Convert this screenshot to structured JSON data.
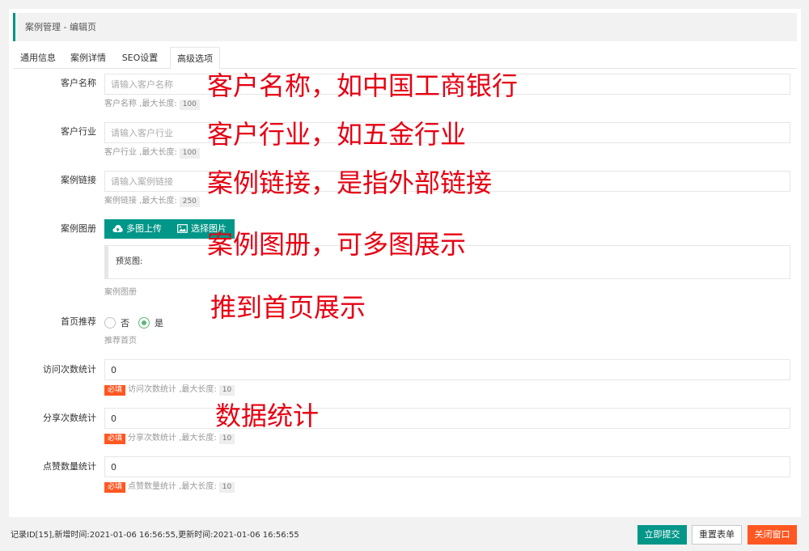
{
  "breadcrumb": "案例管理 - 编辑页",
  "tabs": [
    "通用信息",
    "案例详情",
    "SEO设置",
    "高级选项"
  ],
  "fields": {
    "customer_name": {
      "label": "客户名称",
      "placeholder": "请输入客户名称",
      "hint": "客户名称 ,最大长度:",
      "maxlen": "100"
    },
    "customer_industry": {
      "label": "客户行业",
      "placeholder": "请输入客户行业",
      "hint": "客户行业 ,最大长度:",
      "maxlen": "100"
    },
    "case_link": {
      "label": "案例链接",
      "placeholder": "请输入案例链接",
      "hint": "案例链接 ,最大长度:",
      "maxlen": "250"
    },
    "gallery": {
      "label": "案例图册",
      "upload_btn": "多图上传",
      "select_btn": "选择图片",
      "preview_label": "预览图:",
      "hint": "案例图册"
    },
    "homepage": {
      "label": "首页推荐",
      "option_no": "否",
      "option_yes": "是",
      "selected": "是",
      "hint": "推荐首页"
    },
    "visits": {
      "label": "访问次数统计",
      "value": "0",
      "required": "必填",
      "hint": "访问次数统计 ,最大长度:",
      "maxlen": "10"
    },
    "shares": {
      "label": "分享次数统计",
      "value": "0",
      "required": "必填",
      "hint": "分享次数统计 ,最大长度:",
      "maxlen": "10"
    },
    "likes": {
      "label": "点赞数量统计",
      "value": "0",
      "required": "必填",
      "hint": "点赞数量统计 ,最大长度:",
      "maxlen": "10"
    }
  },
  "annotations": {
    "a1": "客户名称，如中国工商银行",
    "a2": "客户行业，如五金行业",
    "a3": "案例链接，是指外部链接",
    "a4": "案例图册，可多图展示",
    "a5": "推到首页展示",
    "a6": "数据统计"
  },
  "footer": {
    "record_info": "记录ID[15],新增时间:2021-01-06 16:56:55,更新时间:2021-01-06 16:56:55",
    "submit": "立即提交",
    "reset": "重置表单",
    "close": "关闭窗口"
  },
  "colors": {
    "primary": "#009688",
    "danger": "#ff5722",
    "annotation": "#e60012",
    "radio_on": "#5FB878"
  }
}
